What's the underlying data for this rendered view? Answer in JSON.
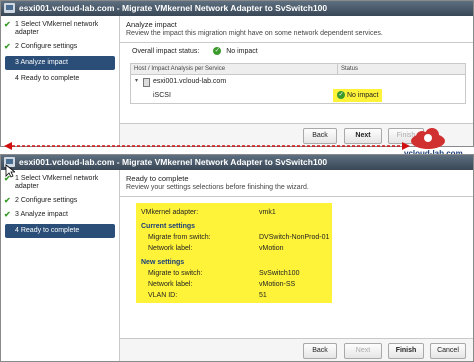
{
  "colors": {
    "titlebar": "#394756",
    "active_step": "#2a4e78",
    "highlight": "#fff33a",
    "arrow": "#d01010",
    "ok": "#3a9a2c"
  },
  "top": {
    "title": "esxi001.vcloud-lab.com - Migrate VMkernel Network Adapter to SvSwitch100",
    "steps": [
      {
        "num": "1",
        "label": "Select VMkernel network adapter",
        "done": true
      },
      {
        "num": "2",
        "label": "Configure settings",
        "done": true
      },
      {
        "num": "3",
        "label": "Analyze impact",
        "active": true
      },
      {
        "num": "4",
        "label": "Ready to complete"
      }
    ],
    "header_title": "Analyze impact",
    "header_sub": "Review the impact this migration might have on some network dependent services.",
    "overall_label": "Overall impact status:",
    "overall_value": "No impact",
    "col_host": "Host / Impact Analysis per Service",
    "col_status": "Status",
    "host_row": "esxi001.vcloud-lab.com",
    "service": "iSCSI",
    "service_status": "No impact",
    "buttons": {
      "back": "Back",
      "next": "Next",
      "finish": "Finish"
    }
  },
  "watermark": {
    "text": "vcloud-lab.com",
    "sub": "http://vcloud-lab.com"
  },
  "bottom": {
    "title": "esxi001.vcloud-lab.com - Migrate VMkernel Network Adapter to SvSwitch100",
    "steps": [
      {
        "num": "1",
        "label": "Select VMkernel network adapter",
        "done": true
      },
      {
        "num": "2",
        "label": "Configure settings",
        "done": true
      },
      {
        "num": "3",
        "label": "Analyze impact",
        "done": true
      },
      {
        "num": "4",
        "label": "Ready to complete",
        "active": true
      }
    ],
    "header_title": "Ready to complete",
    "header_sub": "Review your settings selections before finishing the wizard.",
    "vmk_label": "VMkernel adapter:",
    "vmk_value": "vmk1",
    "current_heading": "Current settings",
    "cur_switch_label": "Migrate from switch:",
    "cur_switch_value": "DVSwitch-NonProd-01",
    "cur_net_label": "Network label:",
    "cur_net_value": "vMotion",
    "new_heading": "New settings",
    "new_switch_label": "Migrate to switch:",
    "new_switch_value": "SvSwitch100",
    "new_net_label": "Network label:",
    "new_net_value": "vMotion-SS",
    "vlan_label": "VLAN ID:",
    "vlan_value": "51",
    "buttons": {
      "back": "Back",
      "next": "Next",
      "finish": "Finish",
      "cancel": "Cancel"
    }
  }
}
